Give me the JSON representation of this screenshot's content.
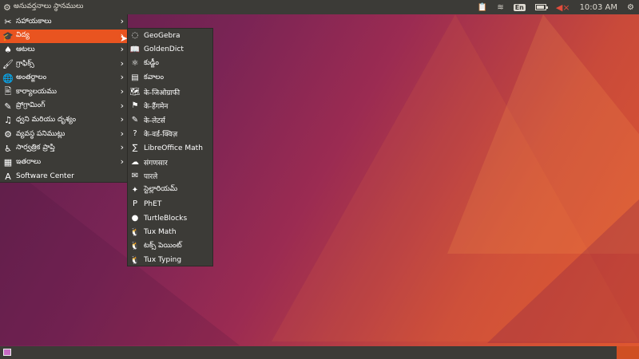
{
  "top_panel": {
    "menu_label": "అనువర్తనాలు స్థానములు",
    "keyboard_layout": "En",
    "clock": "10:03 AM",
    "battery_level": 0.85
  },
  "main_menu": {
    "items": [
      {
        "label": "సహాయకాలు",
        "icon": "accessories-icon",
        "has_submenu": true
      },
      {
        "label": "విద్య",
        "icon": "education-icon",
        "has_submenu": true
      },
      {
        "label": "ఆటలు",
        "icon": "games-icon",
        "has_submenu": true
      },
      {
        "label": "గ్రాఫిక్స్",
        "icon": "graphics-icon",
        "has_submenu": true
      },
      {
        "label": "అంతర్జాలం",
        "icon": "internet-icon",
        "has_submenu": true
      },
      {
        "label": "కార్యాలయము",
        "icon": "office-icon",
        "has_submenu": true
      },
      {
        "label": "ప్రోగ్రామింగ్",
        "icon": "programming-icon",
        "has_submenu": true
      },
      {
        "label": "ధ్వని మరియు దృశ్యం",
        "icon": "sound-video-icon",
        "has_submenu": true
      },
      {
        "label": "వ్యవస్థ పనిముట్లు",
        "icon": "system-tools-icon",
        "has_submenu": true
      },
      {
        "label": "సార్వత్రిక ప్రాప్తి",
        "icon": "universal-access-icon",
        "has_submenu": true
      },
      {
        "label": "ఇతరాలు",
        "icon": "other-icon",
        "has_submenu": true
      },
      {
        "label": "Software Center",
        "icon": "software-center-icon",
        "has_submenu": false
      }
    ],
    "active_index": 1
  },
  "sub_menu": {
    "items": [
      {
        "label": "GeoGebra",
        "icon": "geogebra-icon"
      },
      {
        "label": "GoldenDict",
        "icon": "goldendict-icon"
      },
      {
        "label": "కుడ్జీం",
        "icon": "molecule-icon"
      },
      {
        "label": "కవాలం",
        "icon": "kanagram-icon"
      },
      {
        "label": "के-जिओग्राफी",
        "icon": "kgeography-icon"
      },
      {
        "label": "के-हैंगमेन",
        "icon": "khangman-icon"
      },
      {
        "label": "के-लेटर्स",
        "icon": "kletters-icon"
      },
      {
        "label": "के-वर्ड-क्विज़",
        "icon": "kwordquiz-icon"
      },
      {
        "label": "LibreOffice Math",
        "icon": "libreoffice-math-icon"
      },
      {
        "label": "संगणसार",
        "icon": "calculator-icon"
      },
      {
        "label": "पारले",
        "icon": "parley-icon"
      },
      {
        "label": "స్టెల్లారియమ్",
        "icon": "stellarium-icon"
      },
      {
        "label": "PhET",
        "icon": "phet-icon"
      },
      {
        "label": "TurtleBlocks",
        "icon": "turtle-icon"
      },
      {
        "label": "Tux Math",
        "icon": "tux-math-icon"
      },
      {
        "label": "టక్స్ పెయింట్",
        "icon": "tux-paint-icon"
      },
      {
        "label": "Tux Typing",
        "icon": "tux-typing-icon"
      }
    ]
  },
  "colors": {
    "panel": "#3c3b37",
    "accent": "#e95420"
  }
}
